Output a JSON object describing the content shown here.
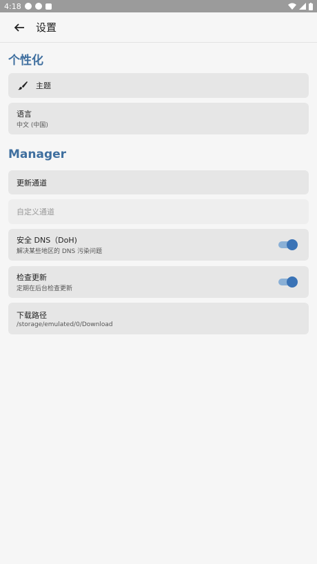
{
  "status_bar": {
    "time": "4:18"
  },
  "app_bar": {
    "title": "设置"
  },
  "sections": {
    "personalization": {
      "title": "个性化",
      "theme": {
        "label": "主题"
      },
      "language": {
        "label": "语言",
        "value": "中文 (中国)"
      }
    },
    "manager": {
      "title": "Manager",
      "update_channel": {
        "label": "更新通道"
      },
      "custom_channel": {
        "label": "自定义通道"
      },
      "secure_dns": {
        "label": "安全 DNS（DoH)",
        "desc": "解决某些地区的 DNS 污染问题",
        "enabled": true
      },
      "check_update": {
        "label": "检查更新",
        "desc": "定期在后台检查更新",
        "enabled": true
      },
      "download_path": {
        "label": "下载路径",
        "value": "/storage/emulated/0/Download"
      }
    }
  },
  "colors": {
    "accent": "#3f6f9f",
    "toggle_thumb": "#3a73b6",
    "toggle_track": "#8ab0d6"
  }
}
